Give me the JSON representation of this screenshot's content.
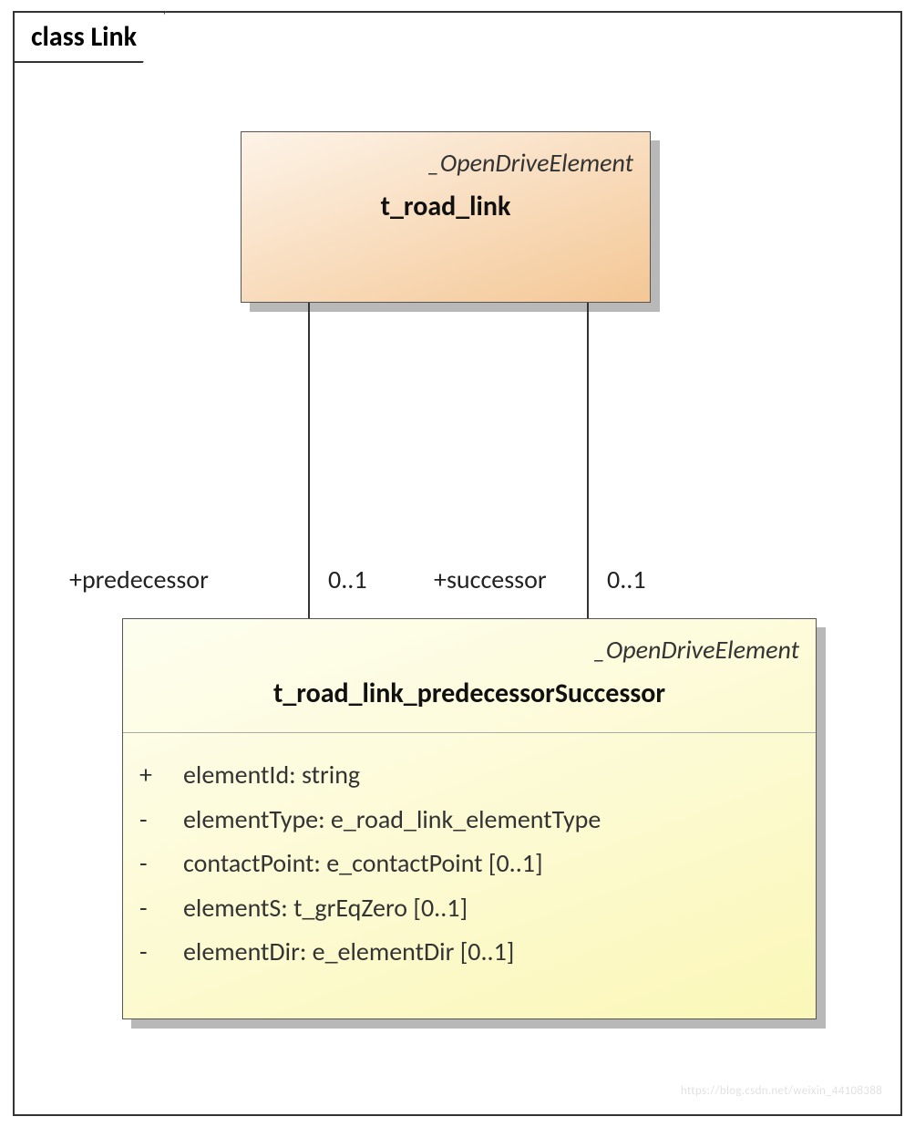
{
  "frame": {
    "title": "class Link"
  },
  "top_class": {
    "stereotype": "_OpenDriveElement",
    "name": "t_road_link"
  },
  "bottom_class": {
    "stereotype": "_OpenDriveElement",
    "name": "t_road_link_predecessorSuccessor",
    "attributes": [
      {
        "visibility": "+",
        "text": "elementId: string"
      },
      {
        "visibility": "-",
        "text": "elementType: e_road_link_elementType"
      },
      {
        "visibility": "-",
        "text": "contactPoint: e_contactPoint [0..1]"
      },
      {
        "visibility": "-",
        "text": "elementS: t_grEqZero [0..1]"
      },
      {
        "visibility": "-",
        "text": "elementDir: e_elementDir [0..1]"
      }
    ]
  },
  "associations": {
    "predecessor": {
      "role": "+predecessor",
      "mult": "0..1"
    },
    "successor": {
      "role": "+successor",
      "mult": "0..1"
    }
  },
  "watermark": "https://blog.csdn.net/weixin_44108388"
}
